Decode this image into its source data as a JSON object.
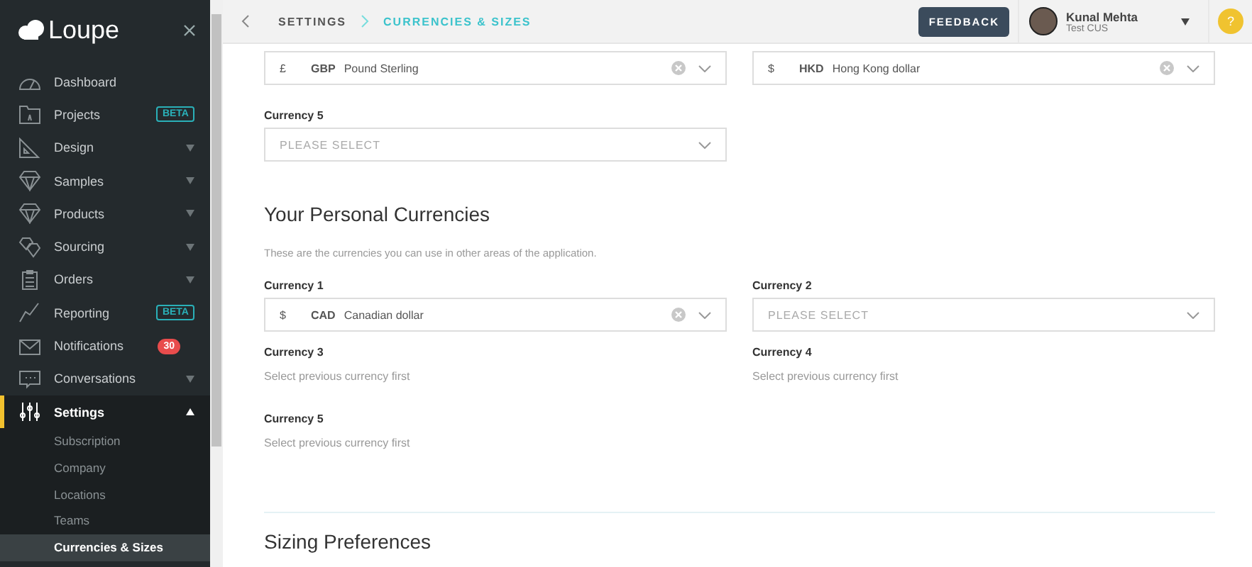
{
  "sidebar": {
    "logo": "Loupe",
    "items": [
      {
        "label": "Dashboard",
        "selected": false
      },
      {
        "label": "Projects",
        "badge": {
          "text": "BETA",
          "kind": "beta"
        },
        "selected": false
      },
      {
        "label": "Design",
        "expandable": true,
        "expanded": false,
        "selected": false
      },
      {
        "label": "Samples",
        "expandable": true,
        "expanded": false,
        "selected": false
      },
      {
        "label": "Products",
        "expandable": true,
        "expanded": false,
        "selected": false
      },
      {
        "label": "Sourcing",
        "expandable": true,
        "expanded": false,
        "selected": false
      },
      {
        "label": "Orders",
        "expandable": true,
        "expanded": false,
        "selected": false
      },
      {
        "label": "Reporting",
        "badge": {
          "text": "BETA",
          "kind": "beta"
        },
        "selected": false
      },
      {
        "label": "Notifications",
        "badge": {
          "text": "30",
          "kind": "count"
        },
        "selected": false
      },
      {
        "label": "Conversations",
        "expandable": true,
        "expanded": false,
        "selected": false
      },
      {
        "label": "Settings",
        "expandable": true,
        "expanded": true,
        "selected": true,
        "children": [
          {
            "label": "Subscription",
            "selected": false
          },
          {
            "label": "Company",
            "selected": false
          },
          {
            "label": "Locations",
            "selected": false
          },
          {
            "label": "Teams",
            "selected": false
          },
          {
            "label": "Currencies & Sizes",
            "selected": true
          }
        ]
      }
    ]
  },
  "header": {
    "breadcrumbs": [
      {
        "label": "SETTINGS",
        "selected": false
      },
      {
        "label": "CURRENCIES & SIZES",
        "selected": true
      }
    ],
    "feedback_button": "FEEDBACK",
    "user": {
      "name": "Kunal Mehta",
      "subtitle": "Test CUS"
    },
    "help": "?"
  },
  "company_currencies": [
    {
      "kind": "select",
      "value": {
        "symbol": "£",
        "code": "GBP",
        "name": "Pound Sterling"
      }
    },
    {
      "kind": "select",
      "value": {
        "symbol": "$",
        "code": "HKD",
        "name": "Hong Kong dollar"
      }
    },
    {
      "kind": "select",
      "label": "Currency 5",
      "placeholder": "PLEASE SELECT"
    }
  ],
  "personal": {
    "title": "Your Personal Currencies",
    "description": "These are the currencies you can use in other areas of the application.",
    "currencies": [
      {
        "kind": "select",
        "label": "Currency 1",
        "value": {
          "symbol": "$",
          "code": "CAD",
          "name": "Canadian dollar"
        }
      },
      {
        "kind": "select",
        "label": "Currency 2",
        "placeholder": "PLEASE SELECT"
      },
      {
        "kind": "locked",
        "label": "Currency 3",
        "note": "Select previous currency first"
      },
      {
        "kind": "locked",
        "label": "Currency 4",
        "note": "Select previous currency first"
      },
      {
        "kind": "locked",
        "label": "Currency 5",
        "note": "Select previous currency first"
      }
    ]
  },
  "next_section_title": "Sizing Preferences"
}
